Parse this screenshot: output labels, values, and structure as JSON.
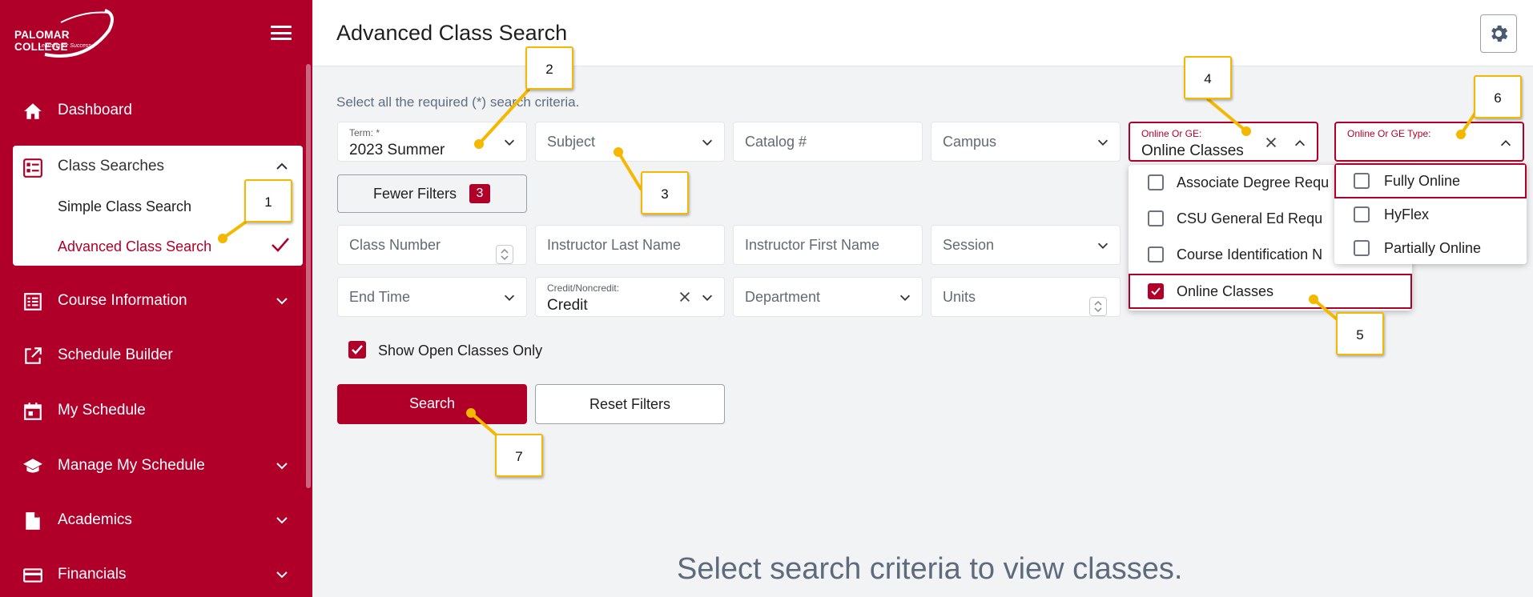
{
  "app": {
    "logo_text": "PALOMAR COLLEGE",
    "logo_tagline": "Learning for Success"
  },
  "sidebar": {
    "items": [
      {
        "label": "Dashboard",
        "icon": "home-icon"
      },
      {
        "label": "Class Searches",
        "icon": "list-icon",
        "expanded": true,
        "children": [
          {
            "label": "Simple Class Search"
          },
          {
            "label": "Advanced Class Search",
            "active": true
          }
        ]
      },
      {
        "label": "Course Information",
        "icon": "catalog-icon"
      },
      {
        "label": "Schedule Builder",
        "icon": "external-link-icon"
      },
      {
        "label": "My Schedule",
        "icon": "calendar-icon"
      },
      {
        "label": "Manage My Schedule",
        "icon": "graduation-cap-icon"
      },
      {
        "label": "Academics",
        "icon": "document-icon"
      },
      {
        "label": "Financials",
        "icon": "credit-card-icon"
      }
    ]
  },
  "header": {
    "title": "Advanced Class Search"
  },
  "form": {
    "hint": "Select all the required (*) search criteria.",
    "term": {
      "label": "Term: *",
      "value": "2023 Summer"
    },
    "subject": {
      "placeholder": "Subject"
    },
    "catalog": {
      "placeholder": "Catalog #"
    },
    "campus": {
      "placeholder": "Campus"
    },
    "online_ge": {
      "label": "Online Or GE:",
      "value": "Online Classes"
    },
    "online_ge_type": {
      "label": "Online Or GE Type:"
    },
    "fewer_filters": {
      "label": "Fewer Filters",
      "count": "3"
    },
    "class_number": {
      "placeholder": "Class Number"
    },
    "instructor_last": {
      "placeholder": "Instructor Last Name"
    },
    "instructor_first": {
      "placeholder": "Instructor First Name"
    },
    "session": {
      "placeholder": "Session"
    },
    "end_time": {
      "placeholder": "End Time"
    },
    "credit": {
      "label": "Credit/Noncredit:",
      "value": "Credit"
    },
    "department": {
      "placeholder": "Department"
    },
    "units": {
      "placeholder": "Units"
    },
    "show_open": {
      "label": "Show Open Classes Only",
      "checked": true
    },
    "search_label": "Search",
    "reset_label": "Reset Filters"
  },
  "online_ge_options": [
    {
      "label": "Associate Degree Requ",
      "checked": false
    },
    {
      "label": "CSU General Ed Requ",
      "checked": false
    },
    {
      "label": "Course Identification N",
      "checked": false
    },
    {
      "label": "Online Classes",
      "checked": true
    }
  ],
  "online_type_options": [
    {
      "label": "Fully Online",
      "checked": false
    },
    {
      "label": "HyFlex",
      "checked": false
    },
    {
      "label": "Partially Online",
      "checked": false
    }
  ],
  "empty_message": "Select search criteria to view classes.",
  "callouts": [
    "1",
    "2",
    "3",
    "4",
    "5",
    "6",
    "7"
  ],
  "colors": {
    "brand": "#b0002a",
    "callout_border": "#f5b800",
    "background": "#f2f3f5"
  }
}
